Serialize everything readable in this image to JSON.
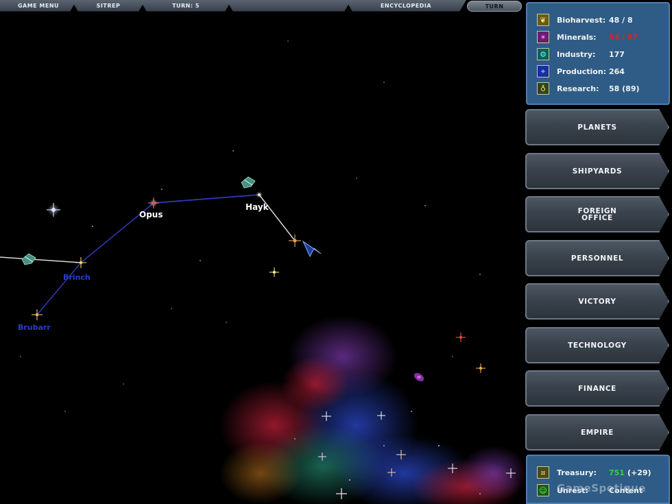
{
  "topbar": {
    "game_menu": "GAME MENU",
    "sitrep": "SITREP",
    "turn_counter": "TURN: 5",
    "encyclopedia": "ENCYCLOPEDIA",
    "turn_button": "TURN"
  },
  "resources": [
    {
      "label": "Bioharvest:",
      "value": "48 / 8",
      "icon": "bioharvest-icon",
      "value_color": "#f2f2f2"
    },
    {
      "label": "Minerals:",
      "value": "94 / 87",
      "icon": "minerals-icon",
      "value_color": "#e02020"
    },
    {
      "label": "Industry:",
      "value": "177",
      "icon": "industry-icon",
      "value_color": "#f2f2f2"
    },
    {
      "label": "Production:",
      "value": "264",
      "icon": "production-icon",
      "value_color": "#f2f2f2"
    },
    {
      "label": "Research:",
      "value": "58 (89)",
      "icon": "research-icon",
      "value_color": "#f2f2f2"
    }
  ],
  "side_menu": [
    {
      "label": "PLANETS"
    },
    {
      "label": "SHIPYARDS"
    },
    {
      "label": "FOREIGN\nOFFICE"
    },
    {
      "label": "PERSONNEL"
    },
    {
      "label": "VICTORY"
    },
    {
      "label": "TECHNOLOGY"
    },
    {
      "label": "FINANCE"
    },
    {
      "label": "EMPIRE"
    }
  ],
  "treasury": {
    "treasury_label": "Treasury:",
    "treasury_value": "751",
    "treasury_delta": "(+29)",
    "unrest_label": "Unrest:",
    "unrest_value": "Content"
  },
  "map": {
    "systems": [
      {
        "name": "Opus",
        "color": "#ffffff"
      },
      {
        "name": "Hayk",
        "color": "#ffffff"
      },
      {
        "name": "Brinch",
        "color": "#2a3ccf"
      },
      {
        "name": "Brubarr",
        "color": "#2a3ccf"
      }
    ]
  },
  "watermark": "GameSpotique",
  "colors": {
    "panel_blue": "#2e5c86",
    "button_grey": "#3a434d",
    "lane_blue": "#3038b8",
    "lane_white": "#d8d8d8"
  }
}
